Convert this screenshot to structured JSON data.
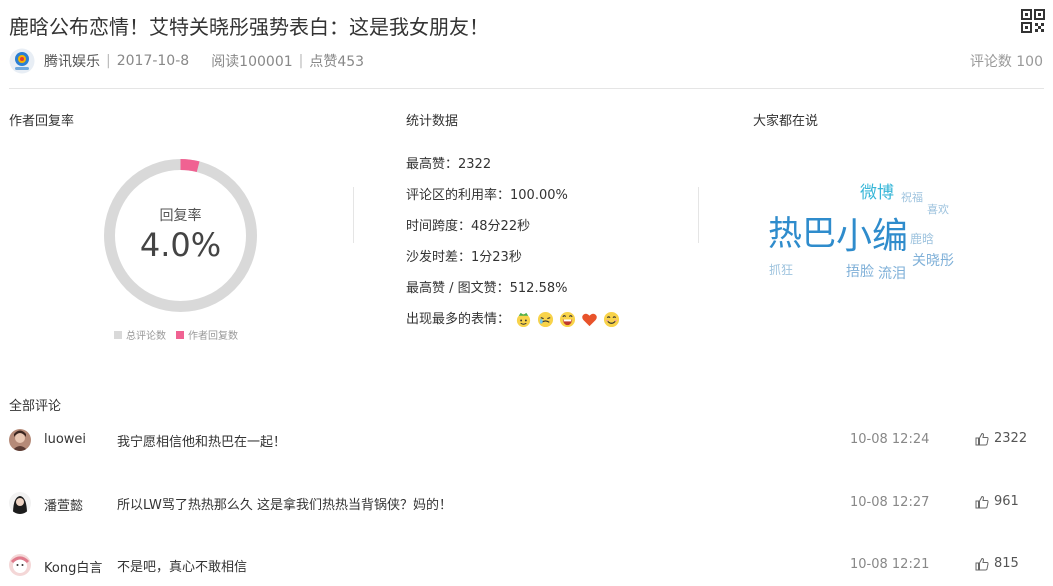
{
  "article": {
    "title": "鹿晗公布恋情！艾特关晓彤强势表白：这是我女朋友！",
    "source": "腾讯娱乐",
    "date": "2017-10-8",
    "reads": "阅读100001",
    "likes": "点赞453",
    "separator": "|",
    "comment_count": "评论数 100"
  },
  "reply_rate": {
    "title": "作者回复率",
    "label": "回复率",
    "value": "4.0%",
    "fraction": 0.04,
    "legend": [
      "总评论数",
      "作者回复数"
    ],
    "colors": {
      "total": "#d9d9d9",
      "author": "#f06292"
    }
  },
  "stats": {
    "title": "统计数据",
    "rows": [
      "最高赞：2322",
      "评论区的利用率：100.00%",
      "时间跨度：48分22秒",
      "沙发时差：1分23秒",
      "最高赞 / 图文赞：512.58%"
    ],
    "emoji_label": "出现最多的表情：",
    "emojis": [
      "crown-baby-emoji",
      "crying-emoji",
      "grin-emoji",
      "heart-emoji",
      "smile-emoji"
    ]
  },
  "word_cloud": {
    "title": "大家都在说",
    "words": [
      {
        "text": "热巴",
        "color": "#2f8ccc"
      },
      {
        "text": "小编",
        "color": "#2f8ccc"
      },
      {
        "text": "微博",
        "color": "#39b7d8"
      },
      {
        "text": "祝福",
        "color": "#9ec3de"
      },
      {
        "text": "喜欢",
        "color": "#9ec3de"
      },
      {
        "text": "鹿晗",
        "color": "#9ec3de"
      },
      {
        "text": "关晓彤",
        "color": "#7fb0d8"
      },
      {
        "text": "抓狂",
        "color": "#9ec3de"
      },
      {
        "text": "捂脸",
        "color": "#7fb0d8"
      },
      {
        "text": "流泪",
        "color": "#7fb0d8"
      }
    ]
  },
  "comments": {
    "title": "全部评论",
    "items": [
      {
        "user": "luowei",
        "text": "我宁愿相信他和热巴在一起！",
        "time": "10-08 12:24",
        "likes": "2322"
      },
      {
        "user": "潘萱懿",
        "text": "所以LW骂了热热那么久 这是拿我们热热当背锅侠？妈的！",
        "time": "10-08 12:27",
        "likes": "961"
      },
      {
        "user": "Kong白言",
        "text": "不是吧，真心不敢相信",
        "time": "10-08 12:21",
        "likes": "815"
      }
    ]
  }
}
